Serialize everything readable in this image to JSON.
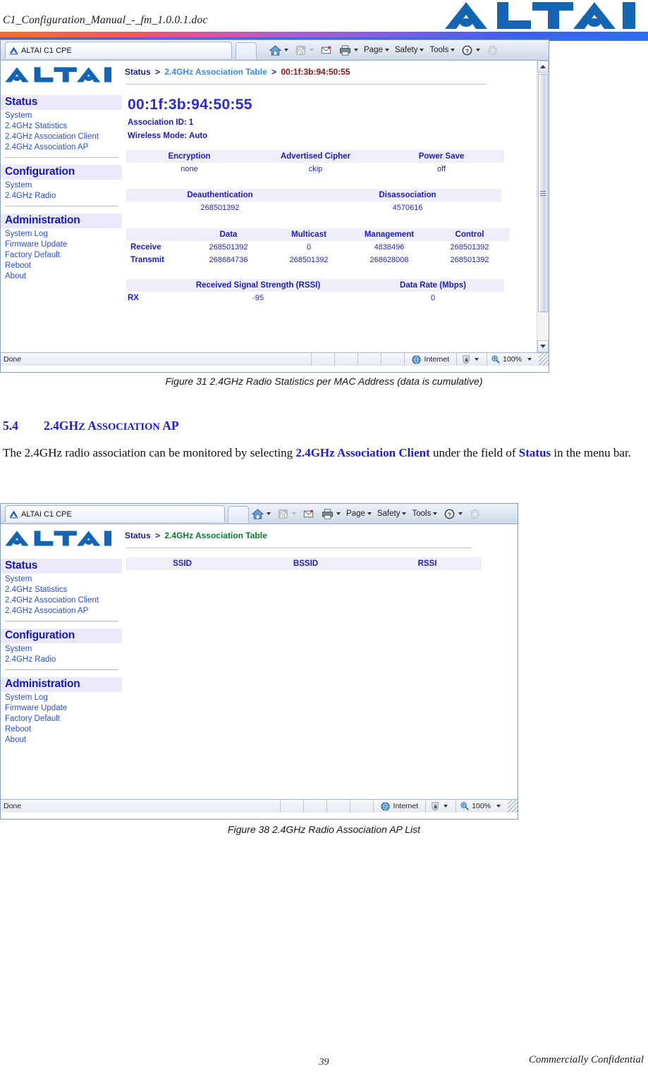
{
  "document": {
    "title": "C1_Configuration_Manual_-_fm_1.0.0.1.doc",
    "brand": "ALTAI",
    "page_number": "39",
    "confidentiality": "Commercially Confidential"
  },
  "section": {
    "number": "5.4",
    "title_part1": "2.4GH",
    "title_part2": "Z",
    "title_part3": " A",
    "title_part4": "SSOCIATION",
    "title_part5": " AP",
    "title_full": "5.4    2.4GHz ASSOCIATION AP",
    "paragraph_pre": "The 2.4GHz radio association can be monitored by selecting ",
    "paragraph_link1": "2.4GHz Association Client",
    "paragraph_mid": " under the field of ",
    "paragraph_link2": "Status",
    "paragraph_post": " in the menu bar."
  },
  "browser": {
    "tab_label": "ALTAI C1 CPE",
    "toolbar": {
      "home": "home-icon",
      "feeds": "rss-icon",
      "mail": "mail-icon",
      "print": "printer-icon",
      "page_menu": "Page",
      "safety_menu": "Safety",
      "tools_menu": "Tools",
      "help": "help-icon",
      "settings": "gear-icon"
    },
    "statusbar": {
      "status_text": "Done",
      "zone_label": "Internet",
      "zoom_label": "100%"
    }
  },
  "nav": {
    "groups": [
      {
        "heading": "Status",
        "items": [
          "System",
          "2.4GHz Statistics",
          "2.4GHz Association Client",
          "2.4GHz Association AP"
        ]
      },
      {
        "heading": "Configuration",
        "items": [
          "System",
          "2.4GHz Radio"
        ]
      },
      {
        "heading": "Administration",
        "items": [
          "System Log",
          "Firmware Update",
          "Factory Default",
          "Reboot",
          "About"
        ]
      }
    ]
  },
  "figure31": {
    "caption": "Figure 31    2.4GHz Radio Statistics per MAC Address (data is cumulative)",
    "breadcrumb": {
      "root": "Status",
      "sep": ">",
      "mid": "2.4GHz Association Table",
      "leaf": "00:1f:3b:94:50:55"
    },
    "mac_title": "00:1f:3b:94:50:55",
    "association_id": "Association ID: 1",
    "wireless_mode": "Wireless Mode: Auto",
    "table_encryption": {
      "headers": [
        "Encryption",
        "Advertised Cipher",
        "Power Save"
      ],
      "values": [
        "none",
        "ckip",
        "off"
      ]
    },
    "table_deauth": {
      "headers": [
        "Deauthentication",
        "Disassociation"
      ],
      "values": [
        "268501392",
        "4570616"
      ]
    },
    "table_traffic": {
      "headers": [
        "",
        "Data",
        "Multicast",
        "Management",
        "Control"
      ],
      "rows": [
        {
          "label": "Receive",
          "values": [
            "268501392",
            "0",
            "4838496",
            "268501392"
          ]
        },
        {
          "label": "Transmit",
          "values": [
            "268684736",
            "268501392",
            "268628008",
            "268501392"
          ]
        }
      ]
    },
    "table_rssi": {
      "headers": [
        "",
        "Received Signal Strength (RSSI)",
        "Data Rate (Mbps)"
      ],
      "rows": [
        {
          "label": "RX",
          "values": [
            "-95",
            "0"
          ]
        }
      ]
    }
  },
  "figure38": {
    "caption": "Figure 38    2.4GHz Radio Association AP List",
    "breadcrumb": {
      "root": "Status",
      "sep": ">",
      "mid": "2.4GHz Association Table"
    },
    "table_assoc": {
      "headers": [
        "SSID",
        "BSSID",
        "RSSI"
      ],
      "rows": []
    }
  },
  "colors": {
    "brand_blue": "#1464b4",
    "nav_heading": "#1515c8",
    "nav_link": "#2a4fd6",
    "table_header_bg": "#f0eff9",
    "crumb_root": "#1d1d8c",
    "crumb_mid_blue": "#3b8ae0",
    "crumb_mid_green": "#0a7a2e",
    "crumb_leaf": "#8a1414",
    "heading_blue": "#1a1ae0"
  }
}
